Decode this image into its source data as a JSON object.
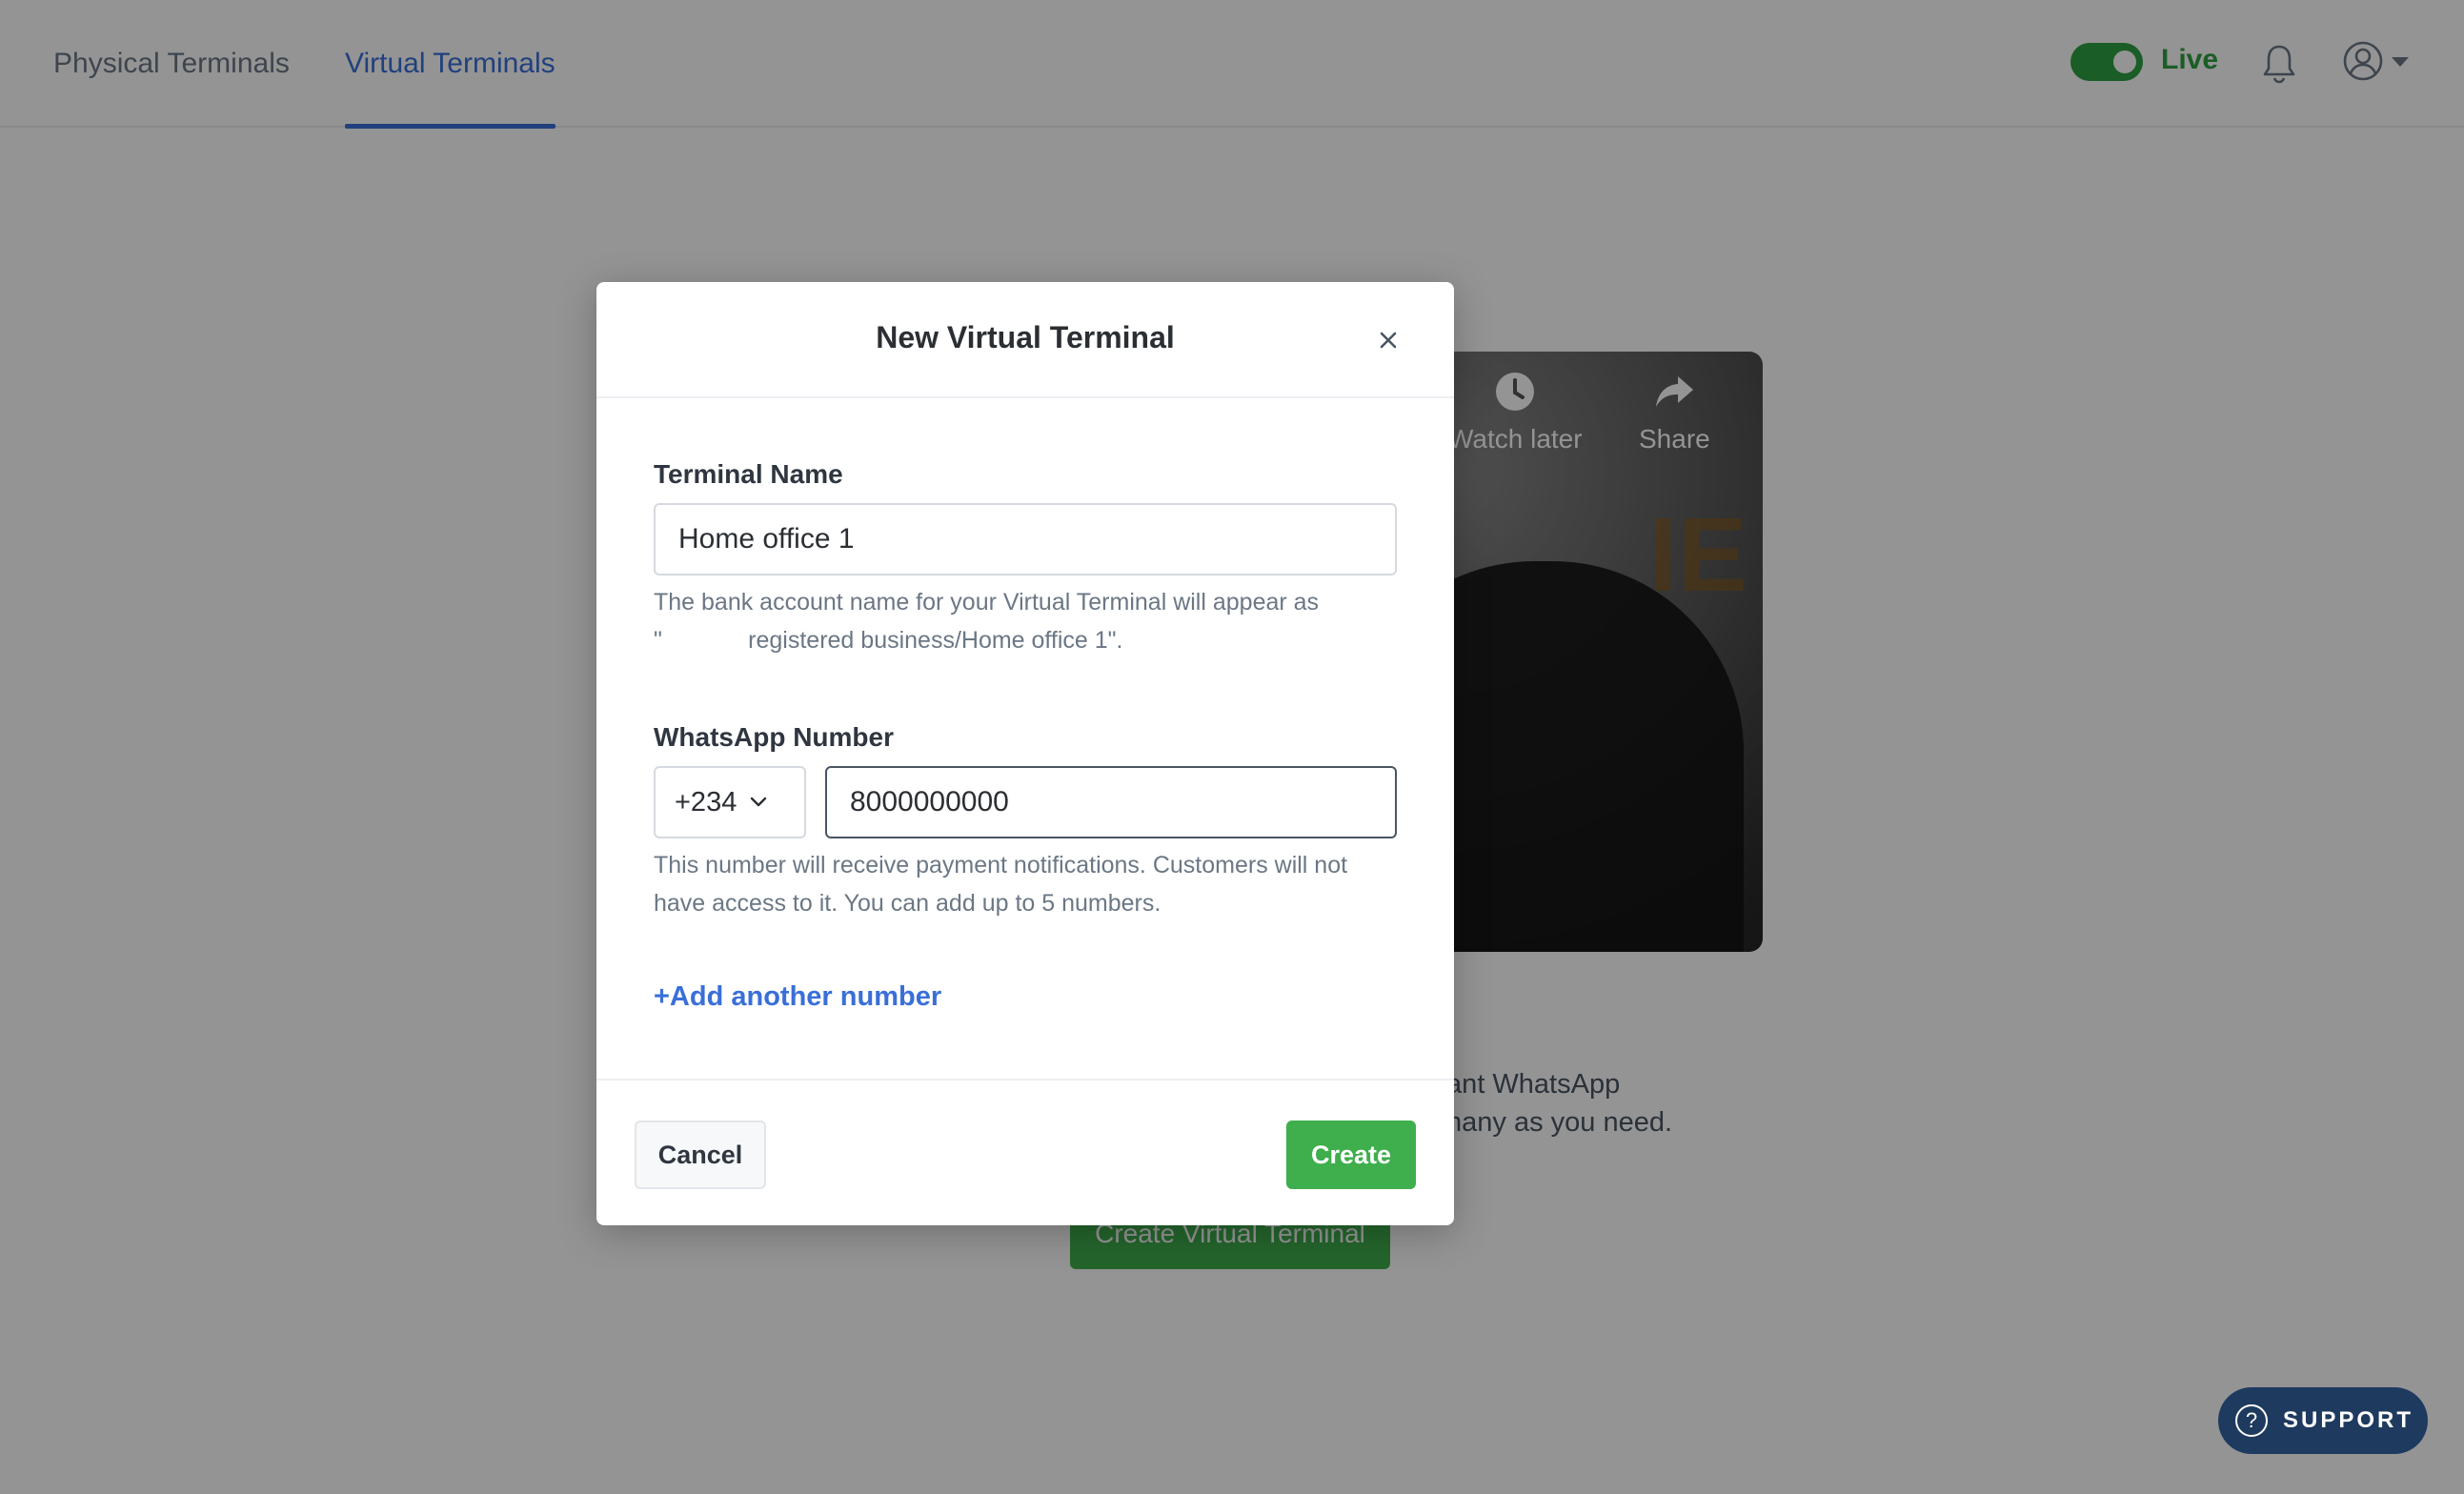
{
  "nav": {
    "tabs": [
      {
        "label": "Physical Terminals",
        "active": false
      },
      {
        "label": "Virtual Terminals",
        "active": true
      }
    ],
    "live_label": "Live",
    "live_on": true,
    "icons": {
      "notifications": "bell-icon",
      "account": "user-circle-icon",
      "menu": "caret-down-icon"
    }
  },
  "background": {
    "video_actions": [
      {
        "label": "Watch later",
        "icon": "clock-icon"
      },
      {
        "label": "Share",
        "icon": "share-icon"
      }
    ],
    "description_line1": "tant WhatsApp",
    "description_line2": "many as you need.",
    "create_button": "Create Virtual Terminal",
    "support_label": "SUPPORT"
  },
  "modal": {
    "title": "New Virtual Terminal",
    "terminal_name": {
      "label": "Terminal Name",
      "value": "Home office 1",
      "help_line1": "The bank account name for your Virtual Terminal will appear as",
      "help_line2": "\"             registered business/Home office 1\"."
    },
    "whatsapp": {
      "label": "WhatsApp Number",
      "country_code": "+234",
      "number": "8000000000",
      "help_line1": "This number will receive payment notifications. Customers will not",
      "help_line2": "have access to it. You can add up to 5 numbers."
    },
    "add_another": "+Add another number",
    "cancel": "Cancel",
    "create": "Create"
  },
  "colors": {
    "accent_blue": "#3a6fd8",
    "success_green": "#3fae4c",
    "support_navy": "#1e3a5f"
  }
}
